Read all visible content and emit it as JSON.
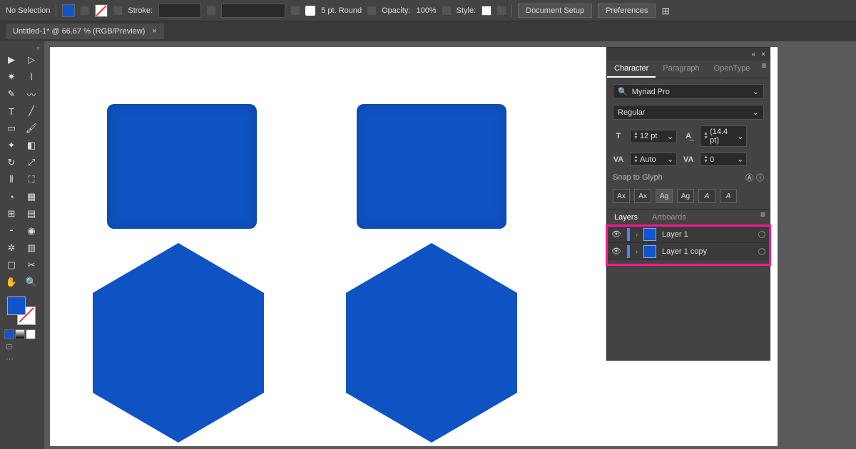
{
  "top": {
    "selection": "No Selection",
    "stroke_label": "Stroke:",
    "stroke_style": "5 pt. Round",
    "opacity_label": "Opacity:",
    "opacity_value": "100%",
    "style_label": "Style:",
    "doc_setup": "Document Setup",
    "preferences": "Preferences"
  },
  "tab": {
    "title": "Untitled-1* @ 66.67 % (RGB/Preview)"
  },
  "character": {
    "tabs": {
      "char": "Character",
      "para": "Paragraph",
      "ot": "OpenType"
    },
    "font": "Myriad Pro",
    "style": "Regular",
    "size": "12 pt",
    "leading": "(14.4 pt)",
    "kerning": "Auto",
    "tracking": "0",
    "snap": "Snap to Glyph",
    "glyphs": {
      "ax": "Ax",
      "ax2": "Ax",
      "ag": "Ag",
      "ag2": "Ag",
      "a1": "A",
      "a2": "A"
    }
  },
  "layers": {
    "tabs": {
      "layers": "Layers",
      "artboards": "Artboards"
    },
    "items": [
      {
        "name": "Layer 1"
      },
      {
        "name": "Layer 1 copy"
      }
    ]
  }
}
